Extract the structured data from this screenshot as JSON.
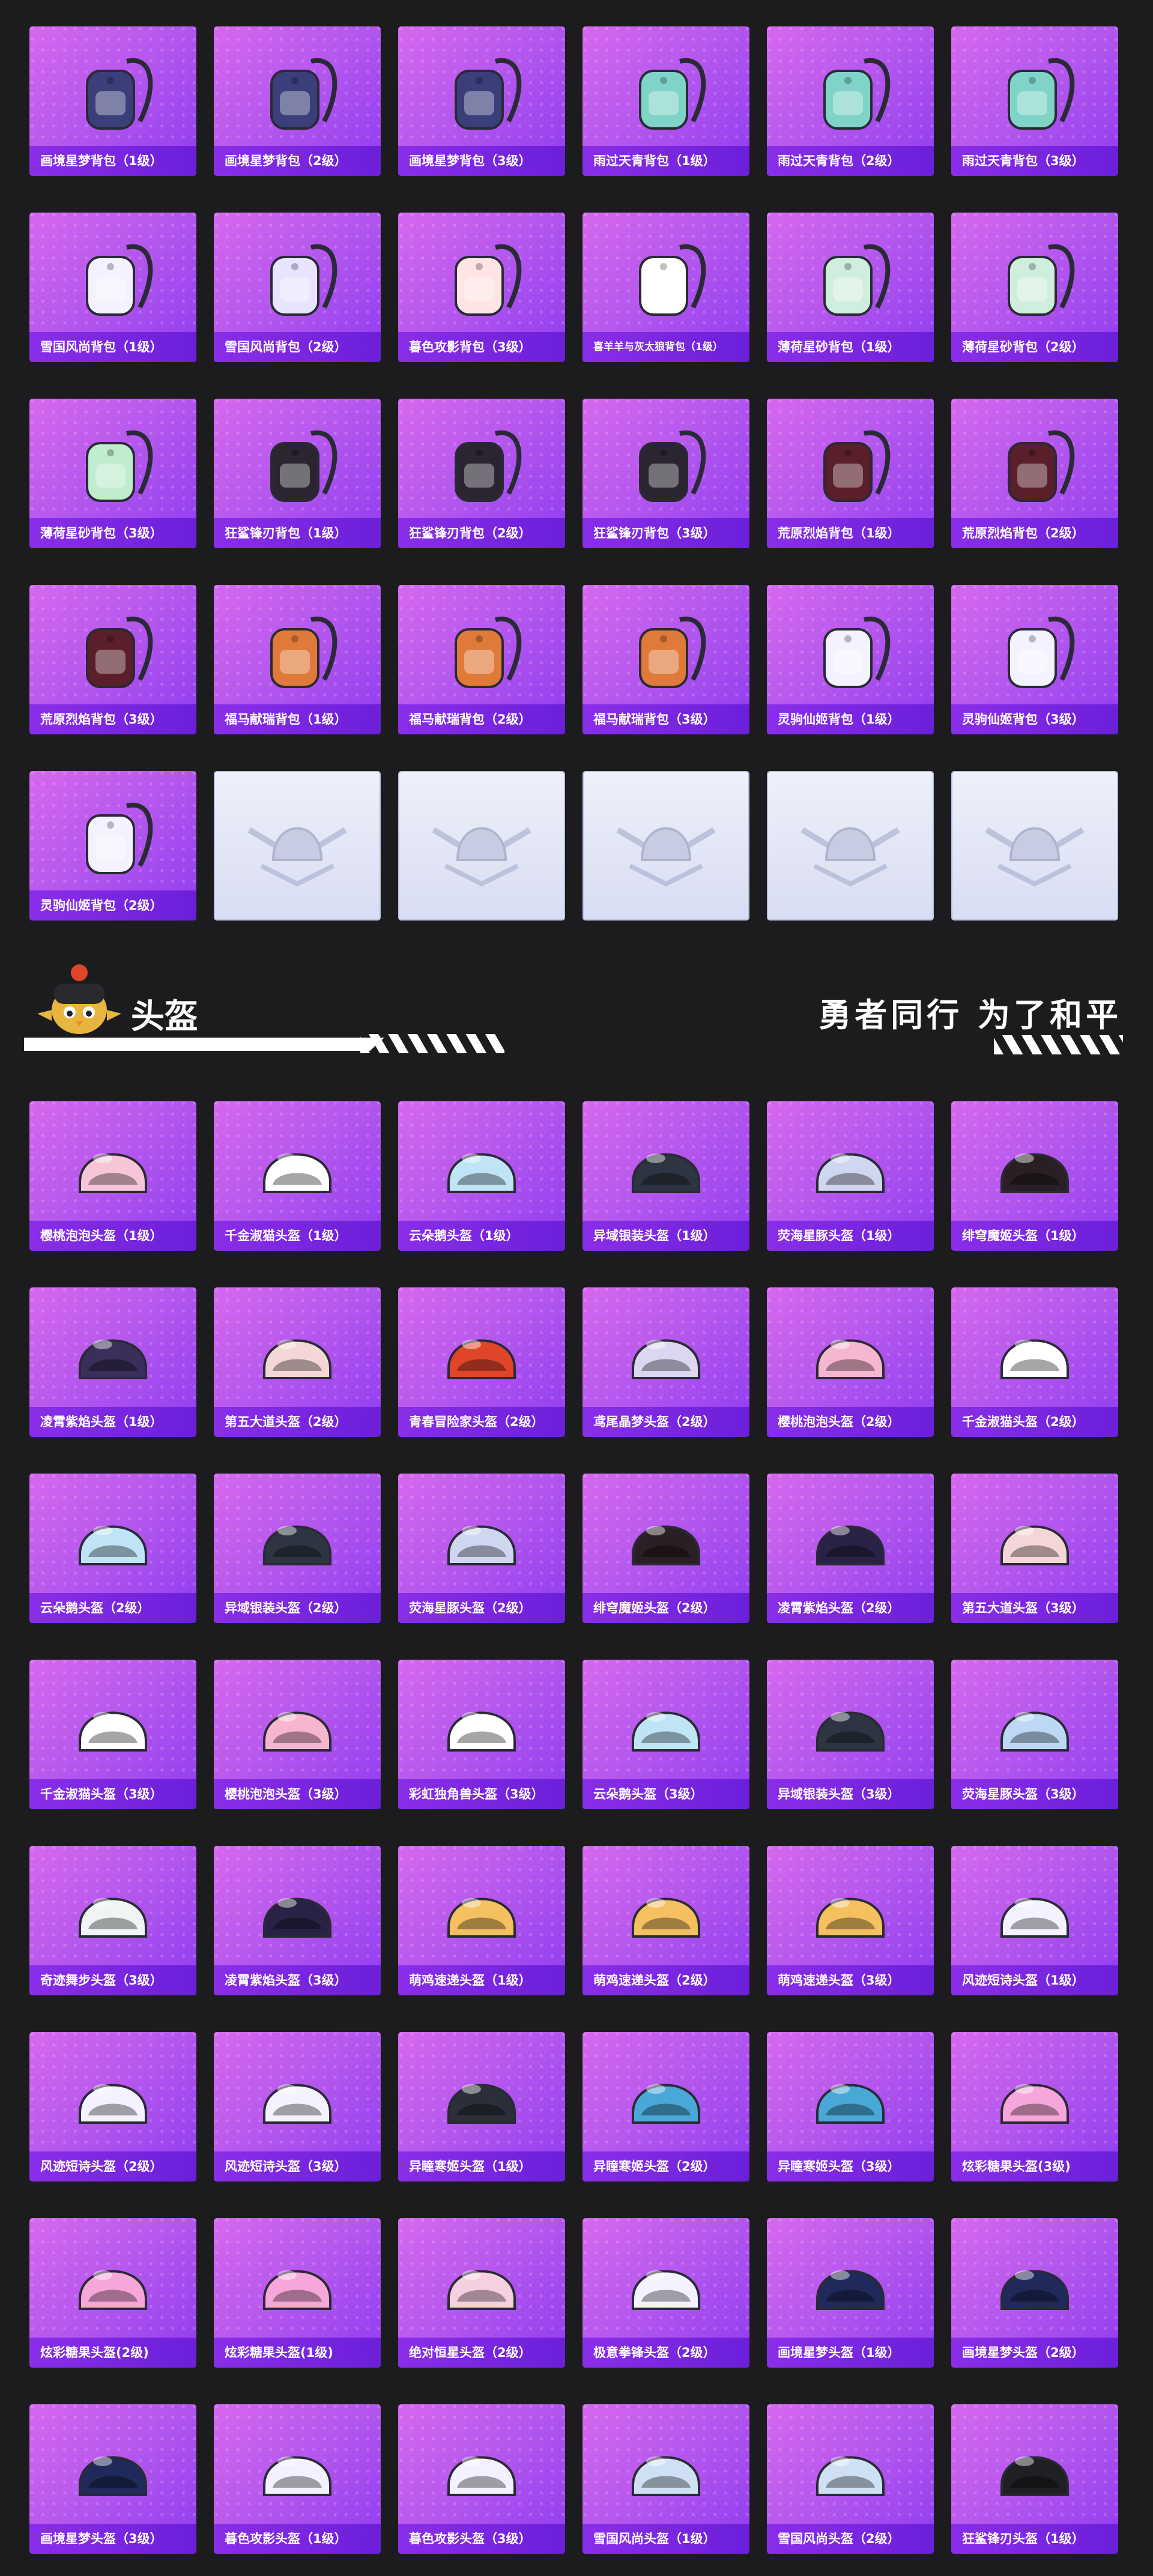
{
  "backpacks": [
    {
      "label": "画境星梦背包（1级）",
      "icon": "backpack-icon",
      "color": "#3a3f7a"
    },
    {
      "label": "画境星梦背包（2级）",
      "icon": "backpack-icon",
      "color": "#3a3f7a"
    },
    {
      "label": "画境星梦背包（3级）",
      "icon": "backpack-icon",
      "color": "#3a3f7a"
    },
    {
      "label": "雨过天青背包（1级）",
      "icon": "backpack-icon",
      "color": "#7fd4c7"
    },
    {
      "label": "雨过天青背包（2级）",
      "icon": "backpack-icon",
      "color": "#7fd4c7"
    },
    {
      "label": "雨过天青背包（3级）",
      "icon": "backpack-icon",
      "color": "#7fd4c7"
    },
    {
      "label": "雪国风尚背包（1级）",
      "icon": "backpack-icon",
      "color": "#f4f2ff"
    },
    {
      "label": "雪国风尚背包（2级）",
      "icon": "backpack-icon",
      "color": "#e8e4ff"
    },
    {
      "label": "暮色攻影背包（3级）",
      "icon": "backpack-icon",
      "color": "#ffe4e4"
    },
    {
      "label": "喜羊羊与灰太狼背包（1级）",
      "icon": "backpack-icon",
      "color": "#ffffff",
      "small": true
    },
    {
      "label": "薄荷星砂背包（1级）",
      "icon": "backpack-icon",
      "color": "#cfeedd"
    },
    {
      "label": "薄荷星砂背包（2级）",
      "icon": "backpack-icon",
      "color": "#cfeedd"
    },
    {
      "label": "薄荷星砂背包（3级）",
      "icon": "backpack-icon",
      "color": "#bfeccd"
    },
    {
      "label": "狂鲨锋刃背包（1级）",
      "icon": "backpack-icon",
      "color": "#2a2530"
    },
    {
      "label": "狂鲨锋刃背包（2级）",
      "icon": "backpack-icon",
      "color": "#2a2530"
    },
    {
      "label": "狂鲨锋刃背包（3级）",
      "icon": "backpack-icon",
      "color": "#2a2530"
    },
    {
      "label": "荒原烈焰背包（1级）",
      "icon": "backpack-icon",
      "color": "#5a1f2a"
    },
    {
      "label": "荒原烈焰背包（2级）",
      "icon": "backpack-icon",
      "color": "#5a1f2a"
    },
    {
      "label": "荒原烈焰背包（3级）",
      "icon": "backpack-icon",
      "color": "#5a1f2a"
    },
    {
      "label": "福马献瑞背包（1级）",
      "icon": "backpack-icon",
      "color": "#e07a3a"
    },
    {
      "label": "福马献瑞背包（2级）",
      "icon": "backpack-icon",
      "color": "#e07a3a"
    },
    {
      "label": "福马献瑞背包（3级）",
      "icon": "backpack-icon",
      "color": "#e07a3a"
    },
    {
      "label": "灵驹仙姬背包（1级）",
      "icon": "backpack-icon",
      "color": "#f3f3ff"
    },
    {
      "label": "灵驹仙姬背包（3级）",
      "icon": "backpack-icon",
      "color": "#f3f3ff"
    },
    {
      "label": "灵驹仙姬背包（2级）",
      "icon": "backpack-icon",
      "color": "#f3f3ff"
    }
  ],
  "empty_slots": 5,
  "section": {
    "title": "头盔",
    "slogan": "勇者同行 为了和平",
    "mascot_icon": "bird-mascot-icon"
  },
  "helmets": [
    {
      "label": "樱桃泡泡头盔（1级）",
      "icon": "helmet-icon",
      "color": "#f6c6d8"
    },
    {
      "label": "千金淑猫头盔（1级）",
      "icon": "helmet-icon",
      "color": "#ffffff"
    },
    {
      "label": "云朵鹅头盔（1级）",
      "icon": "helmet-icon",
      "color": "#bfe4f5"
    },
    {
      "label": "异域银装头盔（1级）",
      "icon": "helmet-icon",
      "color": "#2d3542"
    },
    {
      "label": "荧海星豚头盔（1级）",
      "icon": "helmet-icon",
      "color": "#cfd6f0"
    },
    {
      "label": "绯穹魔姬头盔（1级）",
      "icon": "helmet-icon",
      "color": "#2a1f24"
    },
    {
      "label": "凌霄紫焰头盔（1级）",
      "icon": "helmet-icon",
      "color": "#3a2f5a"
    },
    {
      "label": "第五大道头盔（2级）",
      "icon": "helmet-icon",
      "color": "#f4d6d6"
    },
    {
      "label": "青春冒险家头盔（2级）",
      "icon": "helmet-icon",
      "color": "#e0452a"
    },
    {
      "label": "鸢尾晶梦头盔（2级）",
      "icon": "helmet-icon",
      "color": "#dcd6f0"
    },
    {
      "label": "樱桃泡泡头盔（2级）",
      "icon": "helmet-icon",
      "color": "#f6b6d0"
    },
    {
      "label": "千金淑猫头盔（2级）",
      "icon": "helmet-icon",
      "color": "#ffffff"
    },
    {
      "label": "云朵鹅头盔（2级）",
      "icon": "helmet-icon",
      "color": "#bfe4f5"
    },
    {
      "label": "异域银装头盔（2级）",
      "icon": "helmet-icon",
      "color": "#2d3542"
    },
    {
      "label": "荧海星豚头盔（2级）",
      "icon": "helmet-icon",
      "color": "#cfd6f0"
    },
    {
      "label": "绯穹魔姬头盔（2级）",
      "icon": "helmet-icon",
      "color": "#2a1f24"
    },
    {
      "label": "凌霄紫焰头盔（2级）",
      "icon": "helmet-icon",
      "color": "#2a2246"
    },
    {
      "label": "第五大道头盔（3级）",
      "icon": "helmet-icon",
      "color": "#f4d6d6"
    },
    {
      "label": "千金淑猫头盔（3级）",
      "icon": "helmet-icon",
      "color": "#ffffff"
    },
    {
      "label": "樱桃泡泡头盔（3级）",
      "icon": "helmet-icon",
      "color": "#f6b6d0"
    },
    {
      "label": "彩虹独角兽头盔（3级）",
      "icon": "helmet-icon",
      "color": "#ffffff"
    },
    {
      "label": "云朵鹅头盔（3级）",
      "icon": "helmet-icon",
      "color": "#bfe4f5"
    },
    {
      "label": "异域银装头盔（3级）",
      "icon": "helmet-icon",
      "color": "#2d3542"
    },
    {
      "label": "荧海星豚头盔（3级）",
      "icon": "helmet-icon",
      "color": "#bcd8f4"
    },
    {
      "label": "奇迹舞步头盔（3级）",
      "icon": "helmet-icon",
      "color": "#f0f4f4"
    },
    {
      "label": "凌霄紫焰头盔（3级）",
      "icon": "helmet-icon",
      "color": "#2a2246"
    },
    {
      "label": "萌鸡速递头盔（1级）",
      "icon": "helmet-icon",
      "color": "#f4c060"
    },
    {
      "label": "萌鸡速递头盔（2级）",
      "icon": "helmet-icon",
      "color": "#f4c060"
    },
    {
      "label": "萌鸡速递头盔（3级）",
      "icon": "helmet-icon",
      "color": "#f4c060"
    },
    {
      "label": "风迹短诗头盔（1级）",
      "icon": "helmet-icon",
      "color": "#f4f2ff"
    },
    {
      "label": "风迹短诗头盔（2级）",
      "icon": "helmet-icon",
      "color": "#f4f2ff"
    },
    {
      "label": "风迹短诗头盔（3级）",
      "icon": "helmet-icon",
      "color": "#f4f2ff"
    },
    {
      "label": "异瞳寒姬头盔（1级）",
      "icon": "helmet-icon",
      "color": "#2a2f3a"
    },
    {
      "label": "异瞳寒姬头盔（2级）",
      "icon": "helmet-icon",
      "color": "#4aa8d8"
    },
    {
      "label": "异瞳寒姬头盔（3级）",
      "icon": "helmet-icon",
      "color": "#4aa8d8"
    },
    {
      "label": "炫彩糖果头盔(3级)",
      "icon": "helmet-icon",
      "color": "#f6a6d8"
    },
    {
      "label": "炫彩糖果头盔(2级)",
      "icon": "helmet-icon",
      "color": "#f6a6d8"
    },
    {
      "label": "炫彩糖果头盔(1级)",
      "icon": "helmet-icon",
      "color": "#f6a6d8"
    },
    {
      "label": "绝对恒星头盔（2级）",
      "icon": "helmet-icon",
      "color": "#f6d0e0"
    },
    {
      "label": "极意拳锋头盔（2级）",
      "icon": "helmet-icon",
      "color": "#f4f2ff"
    },
    {
      "label": "画境星梦头盔（1级）",
      "icon": "helmet-icon",
      "color": "#1f2a5a"
    },
    {
      "label": "画境星梦头盔（2级）",
      "icon": "helmet-icon",
      "color": "#1f2a5a"
    },
    {
      "label": "画境星梦头盔（3级）",
      "icon": "helmet-icon",
      "color": "#1f2a5a"
    },
    {
      "label": "暮色攻影头盔（1级）",
      "icon": "helmet-icon",
      "color": "#f4f0ff"
    },
    {
      "label": "暮色攻影头盔（3级）",
      "icon": "helmet-icon",
      "color": "#f4f0ff"
    },
    {
      "label": "雪国风尚头盔（1级）",
      "icon": "helmet-icon",
      "color": "#cfe0f4"
    },
    {
      "label": "雪国风尚头盔（2级）",
      "icon": "helmet-icon",
      "color": "#cfe0f4"
    },
    {
      "label": "狂鲨锋刃头盔（1级）",
      "icon": "helmet-icon",
      "color": "#1f1f24"
    }
  ]
}
